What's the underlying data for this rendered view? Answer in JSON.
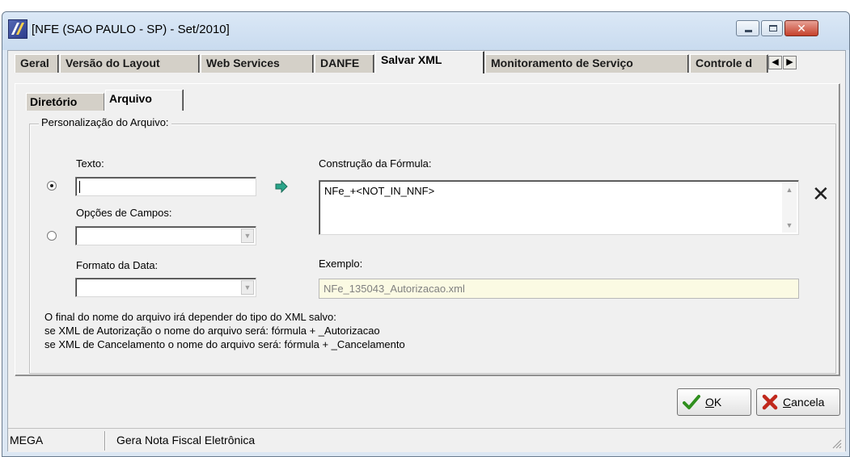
{
  "window": {
    "title": "[NFE (SAO PAULO - SP) - Set/2010]"
  },
  "tabs": {
    "main": [
      "Geral",
      "Versão do Layout",
      "Web Services",
      "DANFE",
      "Salvar XML",
      "Monitoramento de Serviço",
      "Controle d"
    ],
    "active_main": "Salvar XML",
    "sub": [
      "Diretório",
      "Arquivo"
    ],
    "active_sub": "Arquivo"
  },
  "group": {
    "title": "Personalização do Arquivo:"
  },
  "fields": {
    "texto_label": "Texto:",
    "texto_value": "",
    "opcoes_label": "Opções de Campos:",
    "opcoes_value": "",
    "formato_label": "Formato da Data:",
    "formato_value": "",
    "formula_label": "Construção da Fórmula:",
    "formula_value": "NFe_+<NOT_IN_NNF>",
    "exemplo_label": "Exemplo:",
    "exemplo_value": "NFe_135043_Autorizacao.xml"
  },
  "radios": {
    "texto_checked": true,
    "opcoes_checked": false
  },
  "notes": [
    "O final do nome do arquivo irá depender do tipo do XML salvo:",
    "se XML de Autorização o nome do arquivo será: fórmula + _Autorizacao",
    "se XML de Cancelamento o nome do arquivo será: fórmula + _Cancelamento"
  ],
  "buttons": {
    "ok_accel": "O",
    "ok_rest": "K",
    "cancel_accel": "C",
    "cancel_rest": "ancela"
  },
  "statusbar": {
    "left": "MEGA",
    "right": "Gera Nota Fiscal Eletrônica"
  },
  "icons": {
    "app": "app-logo-icon",
    "add_arrow": "arrow-right-icon",
    "clear": "close-x-icon",
    "ok": "check-icon",
    "cancel": "red-x-icon"
  },
  "colors": {
    "example_bg": "#fbfae3",
    "arrow": "#2aa58a",
    "ok_check": "#2f8f1e",
    "cancel_x": "#c0281c"
  }
}
